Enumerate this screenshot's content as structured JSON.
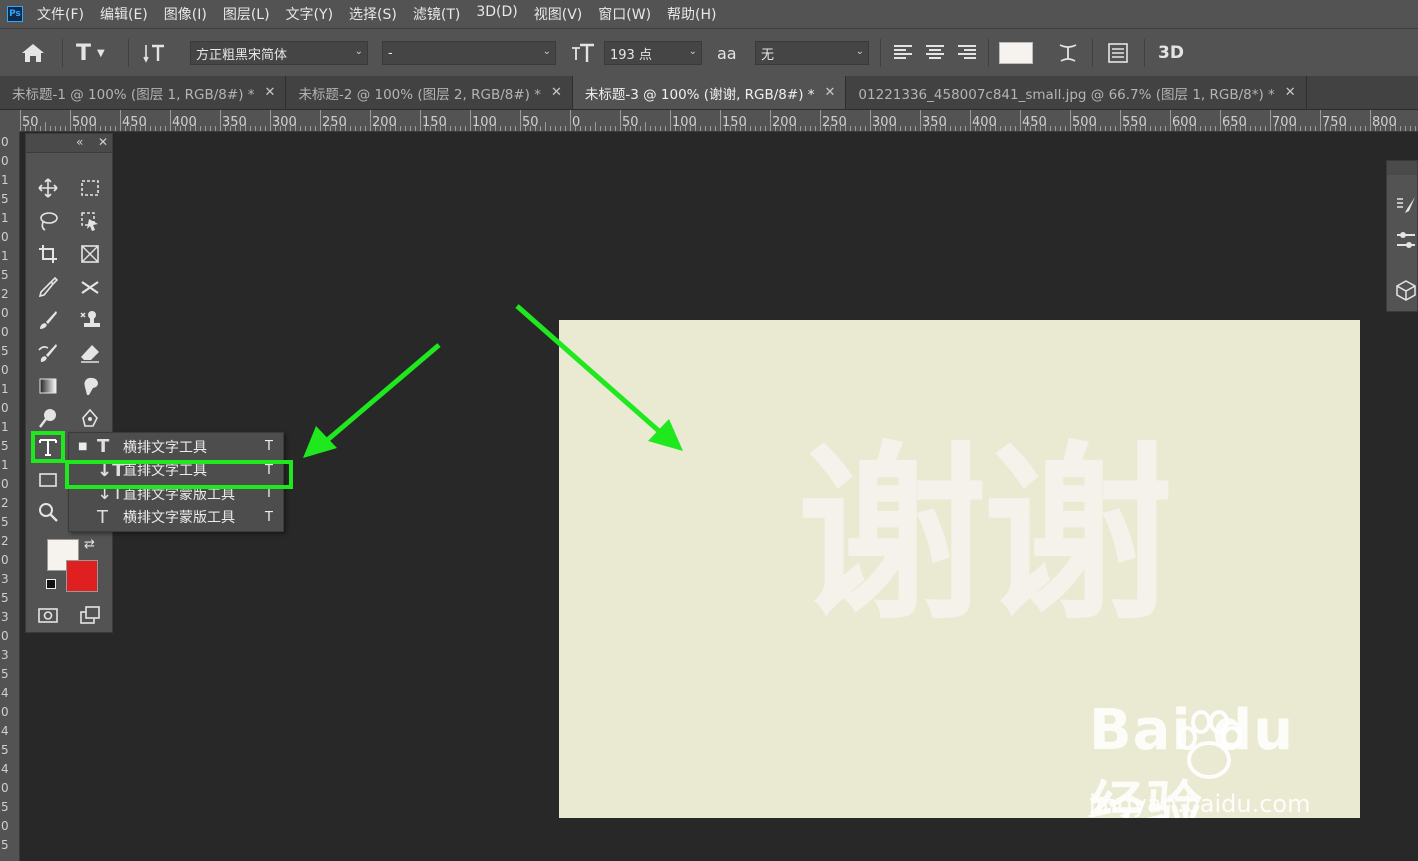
{
  "app": {
    "logo": "Ps"
  },
  "menu": [
    "文件(F)",
    "编辑(E)",
    "图像(I)",
    "图层(L)",
    "文字(Y)",
    "选择(S)",
    "滤镜(T)",
    "3D(D)",
    "视图(V)",
    "窗口(W)",
    "帮助(H)"
  ],
  "options": {
    "font_family": "方正粗黑宋简体",
    "font_style": "-",
    "font_size": "193 点",
    "antialias_icon": "aa",
    "antialias": "无",
    "threed_label": "3D",
    "text_color": "#f6f3ee"
  },
  "tabs": [
    {
      "label": "未标题-1 @ 100% (图层 1, RGB/8#) *",
      "active": false
    },
    {
      "label": "未标题-2 @ 100% (图层 2, RGB/8#) *",
      "active": false
    },
    {
      "label": "未标题-3 @ 100% (谢谢, RGB/8#) *",
      "active": true
    },
    {
      "label": "01221336_458007c841_small.jpg @ 66.7% (图层 1, RGB/8*) *",
      "active": false
    }
  ],
  "ruler": {
    "h_labels": [
      "50",
      "500",
      "450",
      "400",
      "350",
      "300",
      "250",
      "200",
      "150",
      "100",
      "50",
      "0",
      "50",
      "100",
      "150",
      "200",
      "250",
      "300",
      "350",
      "400",
      "450",
      "500",
      "550",
      "600",
      "650",
      "700",
      "750",
      "800",
      "8"
    ],
    "v_labels": [
      "0",
      "0",
      "1",
      "5",
      "1",
      "0",
      "1",
      "5",
      "2",
      "0",
      "0",
      "5",
      "0",
      "1",
      "0",
      "1",
      "5",
      "1",
      "0",
      "2",
      "5",
      "2",
      "0",
      "3",
      "5",
      "3",
      "0",
      "3",
      "5",
      "4",
      "0",
      "4",
      "5",
      "4",
      "0",
      "5",
      "0",
      "5"
    ]
  },
  "flyout": {
    "items": [
      {
        "label": "横排文字工具",
        "icon": "T",
        "key": "T",
        "selected": true
      },
      {
        "label": "直排文字工具",
        "icon": "↓T",
        "key": "T",
        "selected": false
      },
      {
        "label": "直排文字蒙版工具",
        "icon": "↓T",
        "key": "T",
        "selected": false
      },
      {
        "label": "横排文字蒙版工具",
        "icon": "T",
        "key": "T",
        "selected": false
      }
    ],
    "bullet": "■"
  },
  "canvas": {
    "text": "谢谢",
    "bg": "#eae9d1",
    "text_color": "#f5f2ec"
  },
  "colors": {
    "foreground": "#f6f3ee",
    "background": "#e02020",
    "highlight": "#1fe81f"
  },
  "watermark": {
    "brand": "Bai du 经验",
    "url": "jingyan.baidu.com"
  }
}
